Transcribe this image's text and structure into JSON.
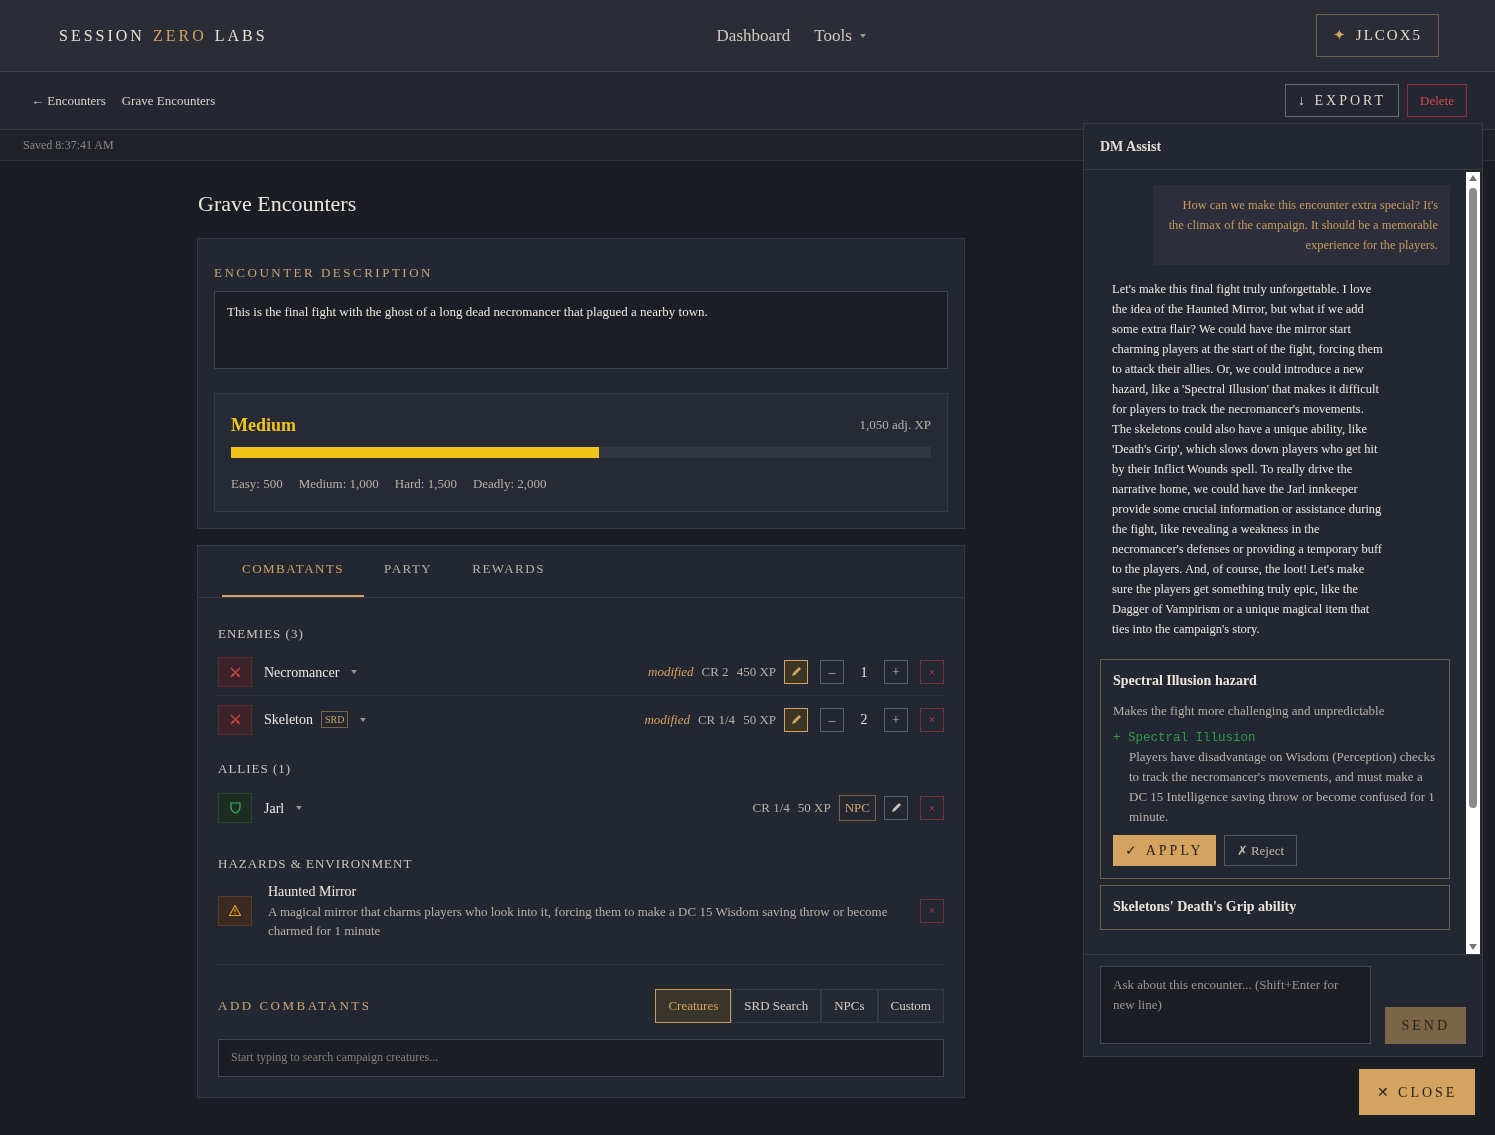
{
  "brand": {
    "words": [
      {
        "text": "SESSION",
        "accent": false
      },
      {
        "text": "ZERO",
        "accent": true
      },
      {
        "text": "LABS",
        "accent": false
      }
    ]
  },
  "nav": [
    {
      "label": "Dashboard",
      "dropdown": false
    },
    {
      "label": "Tools",
      "dropdown": true
    }
  ],
  "user": {
    "icon": "✦",
    "label": "JLCOX5"
  },
  "breadcrumb": [
    {
      "icon": "←",
      "label": "Encounters"
    },
    {
      "label": "Grave Encounters"
    }
  ],
  "actions": {
    "export": {
      "icon": "↓",
      "label": "EXPORT"
    },
    "delete": {
      "label": "Delete"
    }
  },
  "saved": "Saved 8:37:41 AM",
  "title": "Grave Encounters",
  "description": {
    "heading": "ENCOUNTER DESCRIPTION",
    "text": "This is the final fight with the ghost of a long dead necromancer that plagued a nearby town."
  },
  "difficulty": {
    "label": "Medium",
    "xp": "1,050 adj. XP",
    "level": 0.525,
    "thresholds": [
      "Easy: 500",
      "Medium: 1,000",
      "Hard: 1,500",
      "Deadly: 2,000"
    ]
  },
  "tabs": [
    {
      "label": "COMBATANTS",
      "selected": true
    },
    {
      "label": "PARTY",
      "selected": false
    },
    {
      "label": "REWARDS",
      "selected": false
    }
  ],
  "groups": [
    {
      "heading": "ENEMIES (3)",
      "items": [
        {
          "kind": "enemy",
          "name": "Necromancer",
          "modified": "modified",
          "cr": "CR 2",
          "xp": "450 XP",
          "edit_active": true,
          "minus": "–",
          "count": "1",
          "plus": "+",
          "remove": "×"
        },
        {
          "kind": "enemy",
          "name": "Skeleton",
          "badge": "SRD",
          "modified": "modified",
          "cr": "CR 1/4",
          "xp": "50 XP",
          "edit_active": true,
          "minus": "–",
          "count": "2",
          "plus": "+",
          "remove": "×"
        }
      ]
    },
    {
      "heading": "ALLIES (1)",
      "items": [
        {
          "kind": "ally",
          "name": "Jarl",
          "cr": "CR 1/4",
          "xp": "50 XP",
          "tag": "NPC",
          "edit_active": false,
          "remove": "×"
        }
      ]
    }
  ],
  "hazards": {
    "heading": "HAZARDS & ENVIRONMENT",
    "items": [
      {
        "title": "Haunted Mirror",
        "text": "A magical mirror that charms players who look into it, forcing them to make a DC 15 Wisdom saving throw or become charmed for 1 minute",
        "remove": "×"
      }
    ]
  },
  "add": {
    "heading": "ADD COMBATANTS",
    "sources": [
      {
        "label": "Creatures",
        "selected": true
      },
      {
        "label": "SRD Search",
        "selected": false
      },
      {
        "label": "NPCs",
        "selected": false
      },
      {
        "label": "Custom",
        "selected": false
      }
    ],
    "placeholder": "Start typing to search campaign creatures..."
  },
  "assist": {
    "title": "DM Assist",
    "messages": [
      {
        "kind": "user",
        "text": "How can we make this encounter extra special? It's the climax of the campaign. It should be a memorable experience for the players."
      },
      {
        "kind": "assistant",
        "text": "Let's make this final fight truly unforgettable. I love the idea of the Haunted Mirror, but what if we add some extra flair? We could have the mirror start charming players at the start of the fight, forcing them to attack their allies. Or, we could introduce a new hazard, like a 'Spectral Illusion' that makes it difficult for players to track the necromancer's movements. The skeletons could also have a unique ability, like 'Death's Grip', which slows down players who get hit by their Inflict Wounds spell. To really drive the narrative home, we could have the Jarl innkeeper provide some crucial information or assistance during the fight, like revealing a weakness in the necromancer's defenses or providing a temporary buff to the players. And, of course, the loot! Let's make sure the players get something truly epic, like the Dagger of Vampirism or a unique magical item that ties into the campaign's story."
      }
    ],
    "suggestions": [
      {
        "title": "Spectral Illusion hazard",
        "summary": "Makes the fight more challenging and unpredictable",
        "change": {
          "sign": "+",
          "name": "Spectral Illusion",
          "text": "Players have disadvantage on Wisdom (Perception) checks to track the necromancer's movements, and must make a DC 15 Intelligence saving throw or become confused for 1 minute."
        },
        "apply": {
          "icon": "✓",
          "label": "APPLY"
        },
        "reject": {
          "icon": "✗",
          "label": "Reject"
        }
      },
      {
        "title": "Skeletons' Death's Grip ability"
      }
    ],
    "placeholder": "Ask about this encounter... (Shift+Enter for new line)",
    "send": "SEND"
  },
  "close": {
    "icon": "✕",
    "label": "CLOSE"
  }
}
